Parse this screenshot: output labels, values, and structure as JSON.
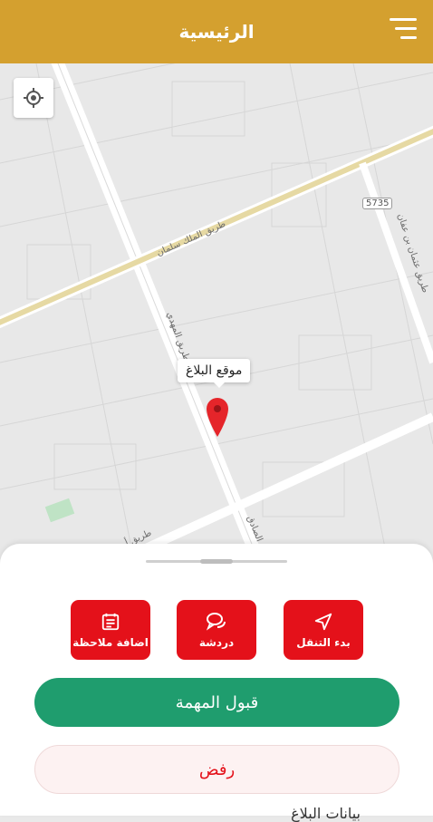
{
  "header": {
    "title": "الرئيسية"
  },
  "map": {
    "road_labels": [
      "طريق الملك سلمان",
      "طريق المهدي",
      "طريق عثمان بن عفان",
      "طريق أبو",
      "الصادق"
    ],
    "shield": "5735",
    "marker_tooltip": "موقع البلاغ"
  },
  "actions": {
    "start_navigation": "بدء التنقل",
    "chat": "دردشة",
    "add_note": "اضافة ملاحظة"
  },
  "buttons": {
    "accept": "قبول المهمة",
    "reject": "رفض"
  },
  "footer": {
    "partial_text": "بيانات البلاغ"
  },
  "colors": {
    "header": "#d4a02f",
    "action": "#e4111a",
    "accept": "#1f9d6e"
  }
}
